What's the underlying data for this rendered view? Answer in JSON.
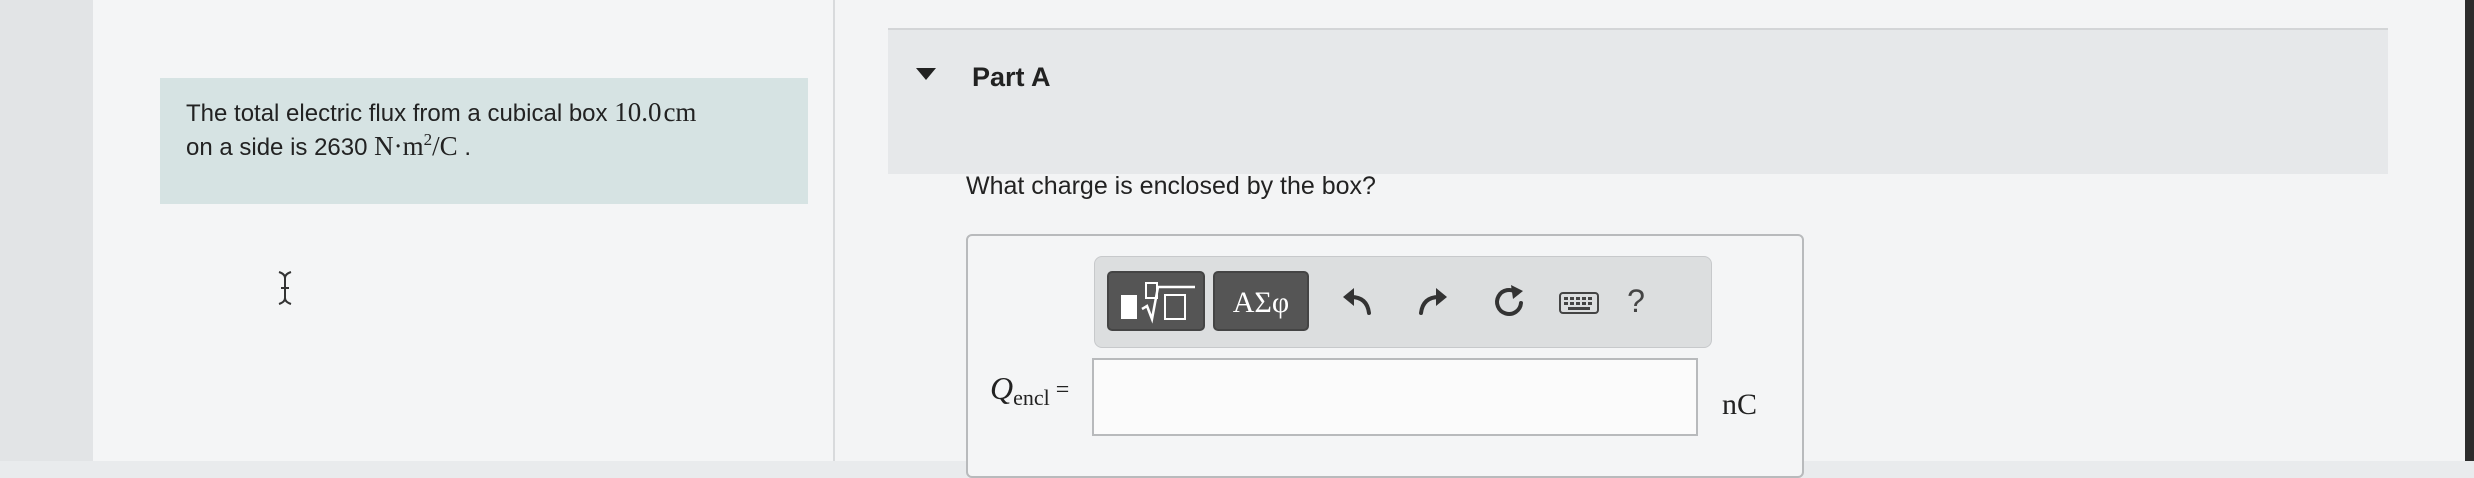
{
  "problem": {
    "text_prefix": "The total electric flux from a cubical box ",
    "side_length": "10.0",
    "length_unit": "cm",
    "text_middle": "on a side is 2630 ",
    "flux_unit_base": "N·m",
    "flux_unit_exp": "2",
    "flux_unit_denom": "/C",
    "text_end": " ."
  },
  "part": {
    "title": "Part A"
  },
  "question": {
    "text": "What charge is enclosed by the box?"
  },
  "toolbar": {
    "symbols_label": "ΑΣφ",
    "help_label": "?"
  },
  "answer": {
    "variable": "Q",
    "subscript": "encl",
    "equals": "=",
    "value": "",
    "unit": "nC"
  },
  "colors": {
    "problem_bg": "#d6e3e3",
    "toolbar_button": "#555555",
    "page_bg": "#f3f4f5"
  }
}
